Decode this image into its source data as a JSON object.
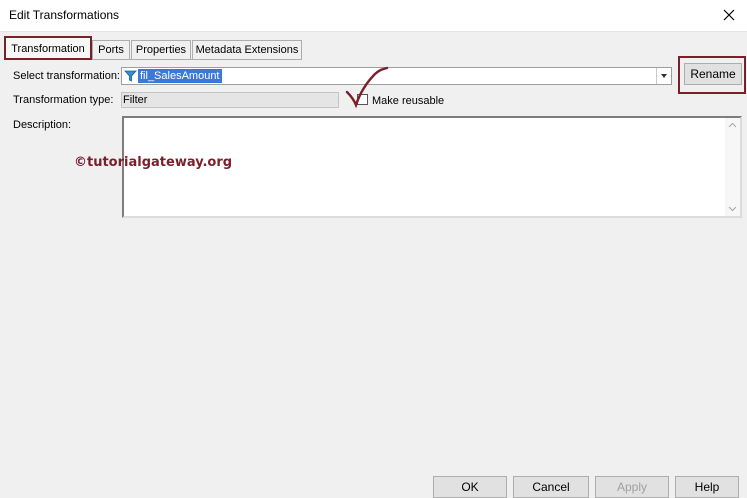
{
  "window": {
    "title": "Edit Transformations"
  },
  "tabs": [
    {
      "label": "Transformation",
      "active": true
    },
    {
      "label": "Ports"
    },
    {
      "label": "Properties"
    },
    {
      "label": "Metadata Extensions"
    }
  ],
  "form": {
    "select_label": "Select transformation:",
    "select_value": "fil_SalesAmount",
    "select_icon": "filter-icon",
    "type_label": "Transformation type:",
    "type_value": "Filter",
    "reusable_label": "Make reusable",
    "reusable_checked": false,
    "description_label": "Description:",
    "description_value": ""
  },
  "buttons": {
    "rename": "Rename",
    "ok": "OK",
    "cancel": "Cancel",
    "apply": "Apply",
    "help": "Help"
  },
  "watermark": "©tutorialgateway.org",
  "colors": {
    "highlight": "#7b1f2b",
    "selection": "#3b78d8"
  }
}
